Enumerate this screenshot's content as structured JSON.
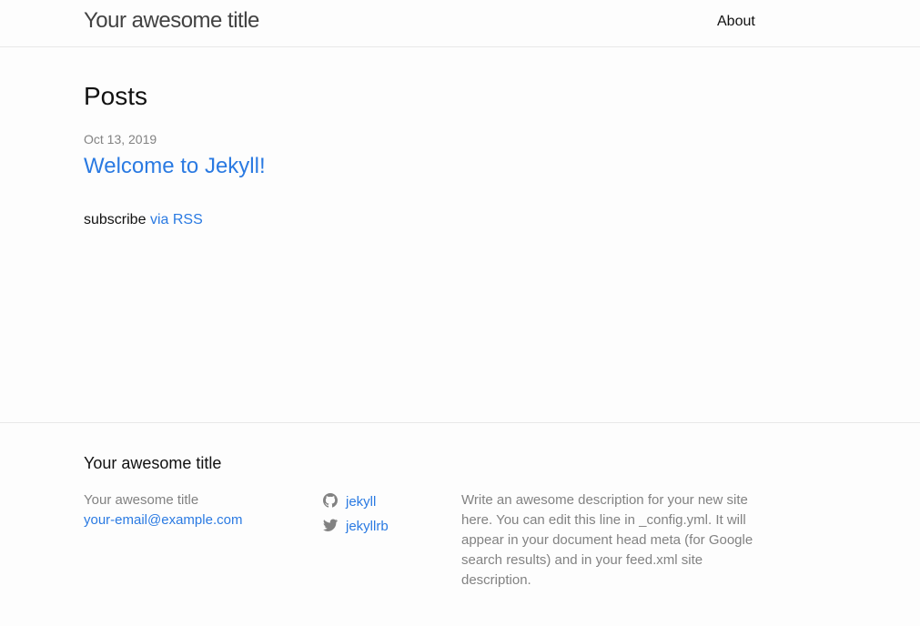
{
  "header": {
    "site_title": "Your awesome title",
    "nav": [
      {
        "label": "About"
      }
    ]
  },
  "main": {
    "heading": "Posts",
    "posts": [
      {
        "date": "Oct 13, 2019",
        "title": "Welcome to Jekyll!"
      }
    ],
    "rss": {
      "prefix": "subscribe",
      "link_label": "via RSS"
    }
  },
  "footer": {
    "heading": "Your awesome title",
    "name": "Your awesome title",
    "email": "your-email@example.com",
    "social": [
      {
        "icon": "github-icon",
        "label": "jekyll"
      },
      {
        "icon": "twitter-icon",
        "label": "jekyllrb"
      }
    ],
    "description": "Write an awesome description for your new site here. You can edit this line in _config.yml. It will appear in your document head meta (for Google search results) and in your feed.xml site description."
  },
  "colors": {
    "link": "#2a7ae2",
    "text": "#111111",
    "muted": "#828282",
    "background": "#fdfdfd",
    "border": "#e8e8e8"
  }
}
